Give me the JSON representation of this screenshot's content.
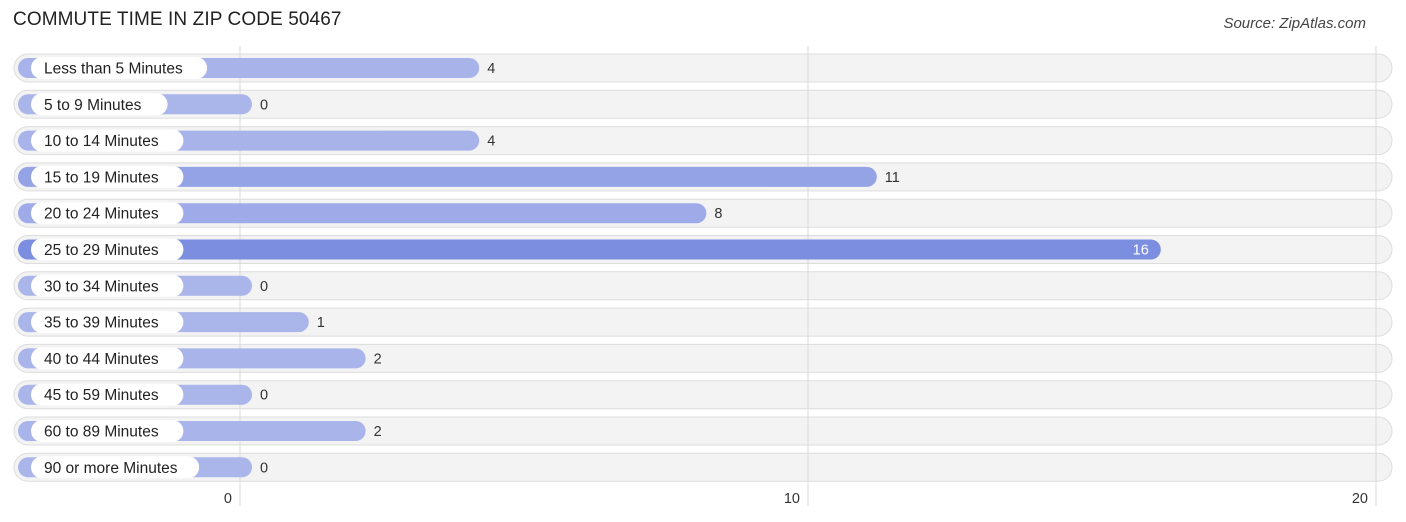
{
  "header": {
    "title": "COMMUTE TIME IN ZIP CODE 50467",
    "source": "Source: ZipAtlas.com"
  },
  "chart_data": {
    "type": "bar",
    "orientation": "horizontal",
    "title": "COMMUTE TIME IN ZIP CODE 50467",
    "xlabel": "",
    "ylabel": "",
    "categories": [
      "Less than 5 Minutes",
      "5 to 9 Minutes",
      "10 to 14 Minutes",
      "15 to 19 Minutes",
      "20 to 24 Minutes",
      "25 to 29 Minutes",
      "30 to 34 Minutes",
      "35 to 39 Minutes",
      "40 to 44 Minutes",
      "45 to 59 Minutes",
      "60 to 89 Minutes",
      "90 or more Minutes"
    ],
    "values": [
      4,
      0,
      4,
      11,
      8,
      16,
      0,
      1,
      2,
      0,
      2,
      0
    ],
    "xlim": [
      0,
      20
    ],
    "xticks": [
      0,
      10,
      20
    ],
    "grid": true,
    "legend": "none",
    "colors": {
      "bar_light": "#aab5ea",
      "bar_dark": "#7b8ee0",
      "row_bg": "#f3f3f3",
      "value_label_inside": "#ffffff"
    }
  }
}
